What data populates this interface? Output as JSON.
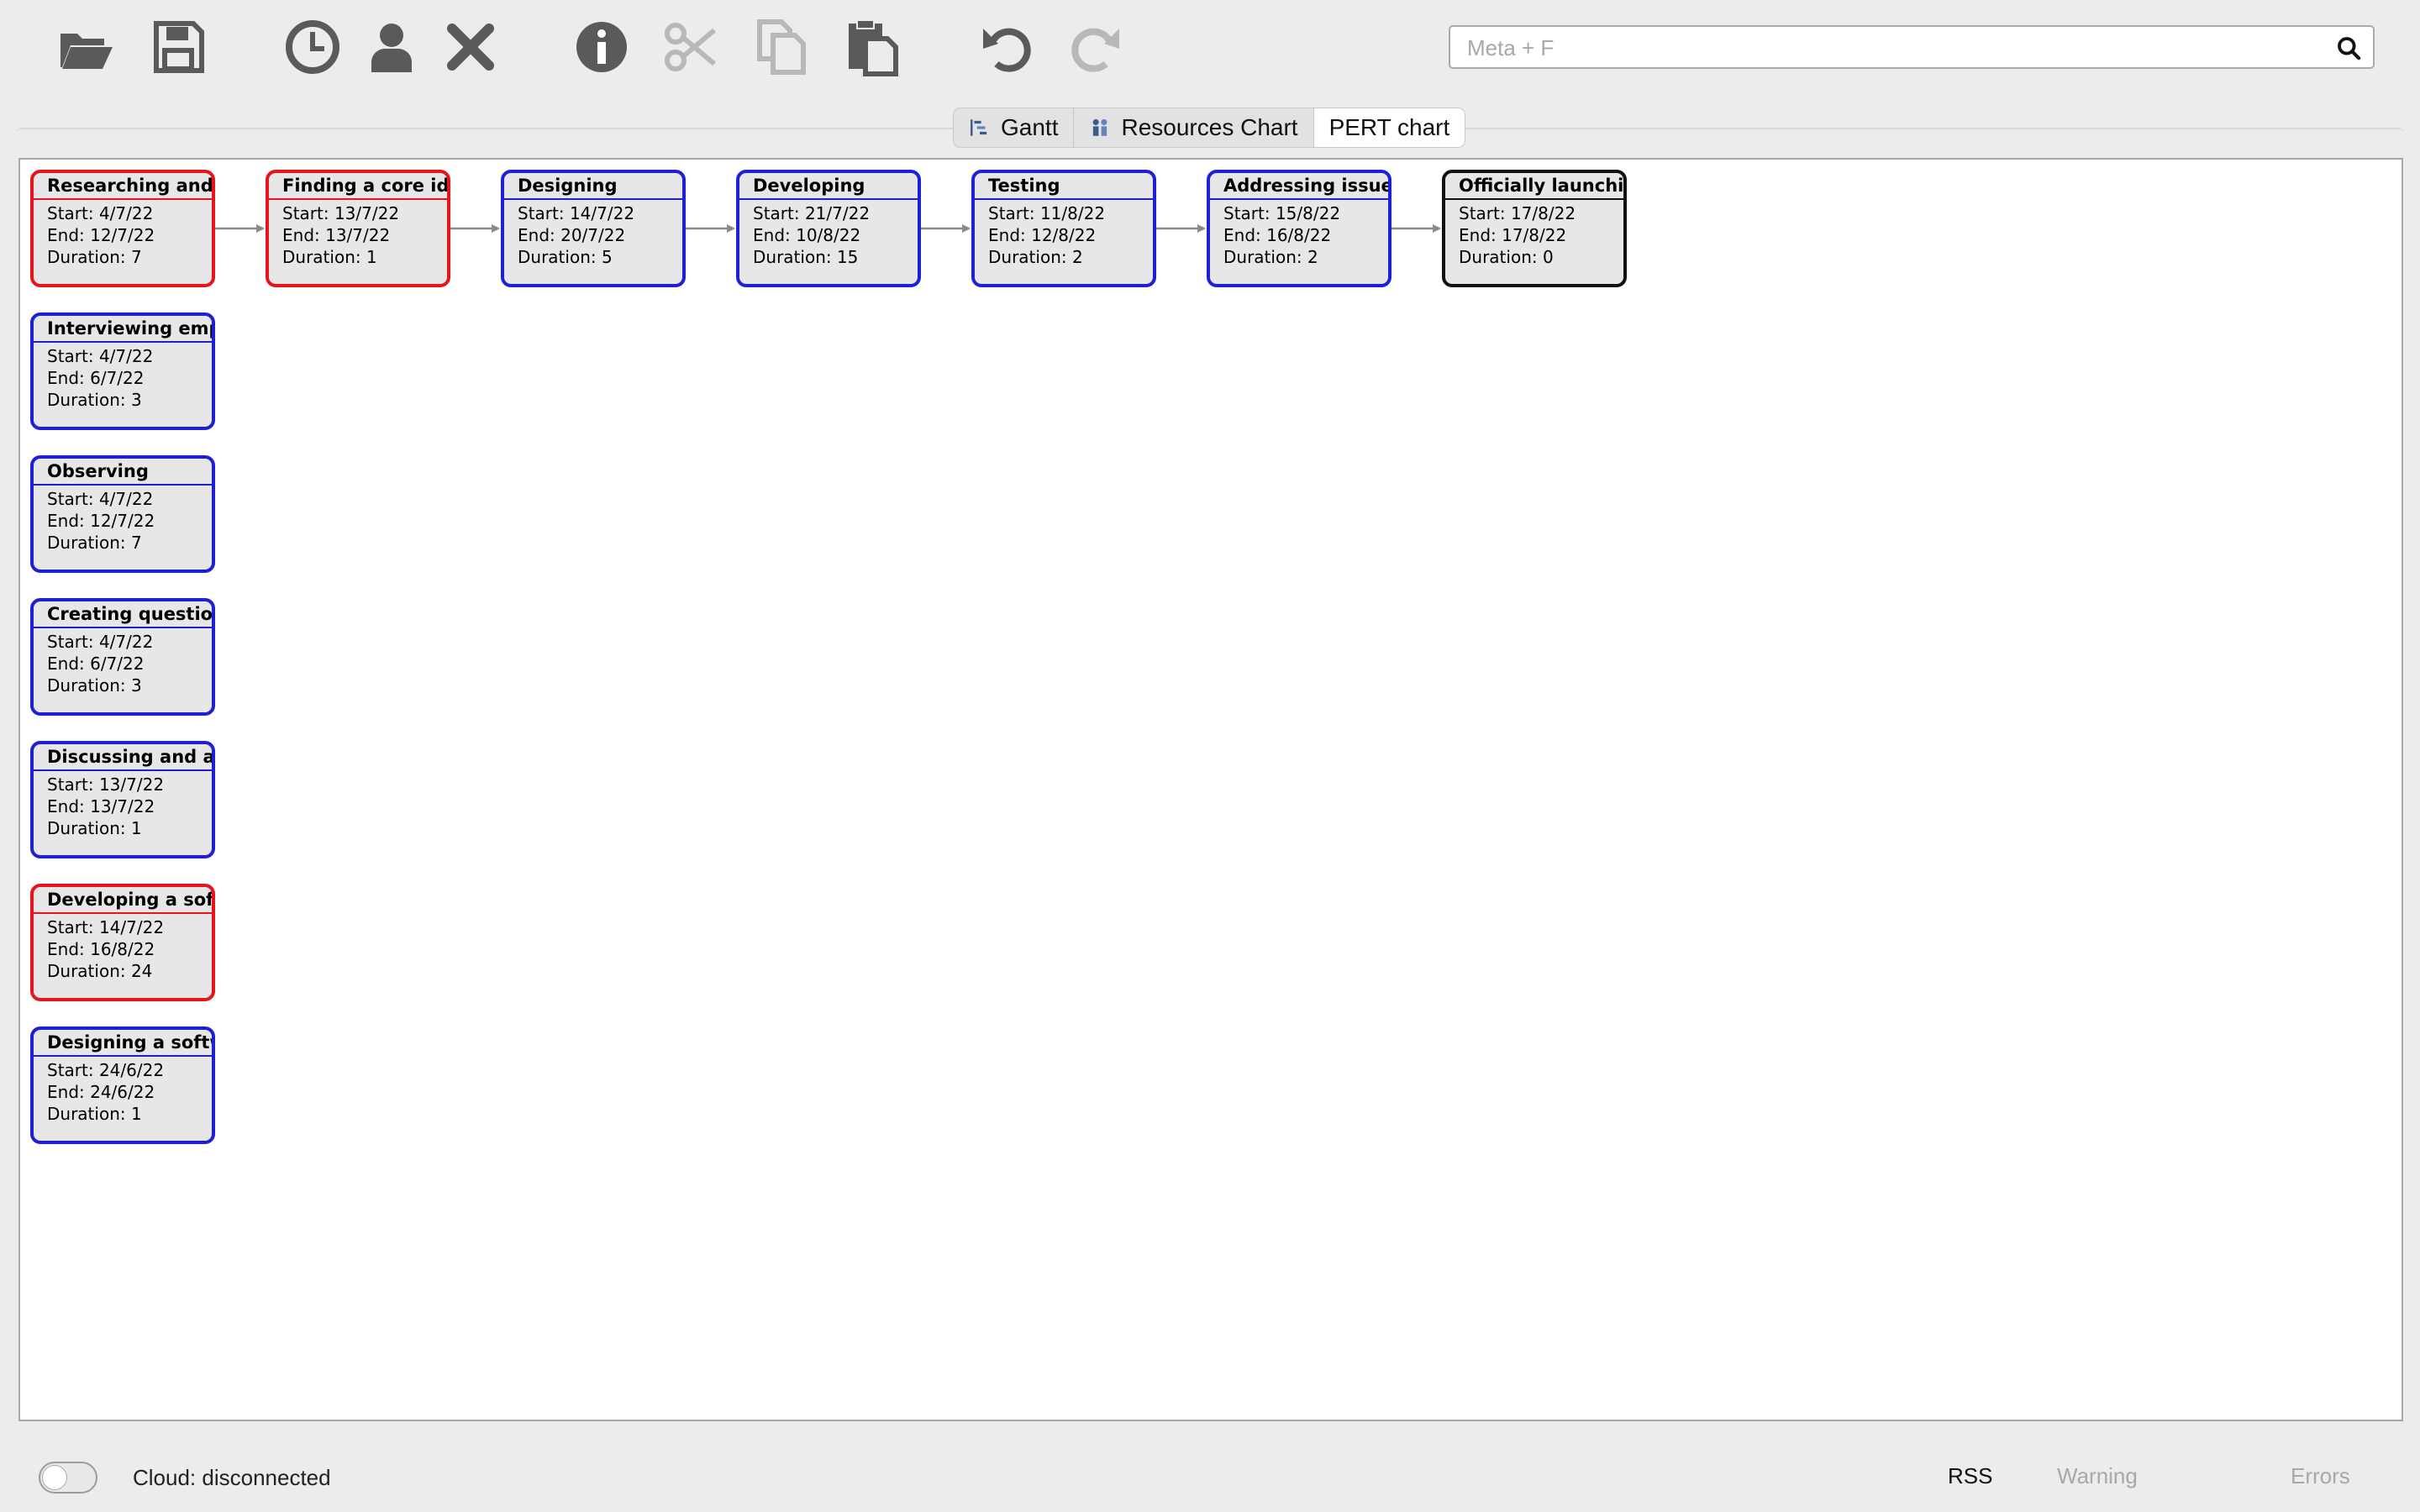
{
  "toolbar": {
    "buttons": [
      {
        "name": "open-icon",
        "enabled": true
      },
      {
        "name": "save-icon",
        "enabled": true
      },
      {
        "name": "clock-icon",
        "enabled": true
      },
      {
        "name": "user-icon",
        "enabled": true
      },
      {
        "name": "delete-icon",
        "enabled": true
      },
      {
        "name": "info-icon",
        "enabled": true
      },
      {
        "name": "cut-icon",
        "enabled": false
      },
      {
        "name": "copy-icon",
        "enabled": false
      },
      {
        "name": "paste-icon",
        "enabled": true
      },
      {
        "name": "undo-icon",
        "enabled": true
      },
      {
        "name": "redo-icon",
        "enabled": false
      }
    ],
    "search": {
      "placeholder": "Meta + F",
      "value": ""
    }
  },
  "tabs": [
    {
      "label": "Gantt",
      "icon": "gantt-icon",
      "active": false
    },
    {
      "label": "Resources Chart",
      "icon": "resources-icon",
      "active": false
    },
    {
      "label": "PERT chart",
      "icon": "",
      "active": true
    }
  ],
  "pert": {
    "nodes": [
      {
        "title": "Researching and g…",
        "start": "Start: 4/7/22",
        "end": "End: 12/7/22",
        "duration": "Duration: 7",
        "critical": true
      },
      {
        "title": "Finding a core idea",
        "start": "Start: 13/7/22",
        "end": "End: 13/7/22",
        "duration": "Duration: 1",
        "critical": true
      },
      {
        "title": "Designing",
        "start": "Start: 14/7/22",
        "end": "End: 20/7/22",
        "duration": "Duration: 5",
        "critical": false
      },
      {
        "title": "Developing",
        "start": "Start: 21/7/22",
        "end": "End: 10/8/22",
        "duration": "Duration: 15",
        "critical": false
      },
      {
        "title": "Testing",
        "start": "Start: 11/8/22",
        "end": "End: 12/8/22",
        "duration": "Duration: 2",
        "critical": false
      },
      {
        "title": "Addressing issues…",
        "start": "Start: 15/8/22",
        "end": "End: 16/8/22",
        "duration": "Duration: 2",
        "critical": false
      },
      {
        "title": "Officially launching…",
        "start": "Start: 17/8/22",
        "end": "End: 17/8/22",
        "duration": "Duration: 0",
        "critical": false,
        "milestone": true
      },
      {
        "title": "Interviewing empl…",
        "start": "Start: 4/7/22",
        "end": "End: 6/7/22",
        "duration": "Duration: 3",
        "critical": false
      },
      {
        "title": "Observing",
        "start": "Start: 4/7/22",
        "end": "End: 12/7/22",
        "duration": "Duration: 7",
        "critical": false
      },
      {
        "title": "Creating question…",
        "start": "Start: 4/7/22",
        "end": "End: 6/7/22",
        "duration": "Duration: 3",
        "critical": false
      },
      {
        "title": "Discussing and an…",
        "start": "Start: 13/7/22",
        "end": "End: 13/7/22",
        "duration": "Duration: 1",
        "critical": false
      },
      {
        "title": "Developing a softw…",
        "start": "Start: 14/7/22",
        "end": "End: 16/8/22",
        "duration": "Duration: 24",
        "critical": true
      },
      {
        "title": "Designing a softw…",
        "start": "Start: 24/6/22",
        "end": "End: 24/6/22",
        "duration": "Duration: 1",
        "critical": false
      }
    ]
  },
  "status": {
    "cloud": "Cloud: disconnected",
    "rss": "RSS",
    "warning": "Warning",
    "errors": "Errors"
  }
}
